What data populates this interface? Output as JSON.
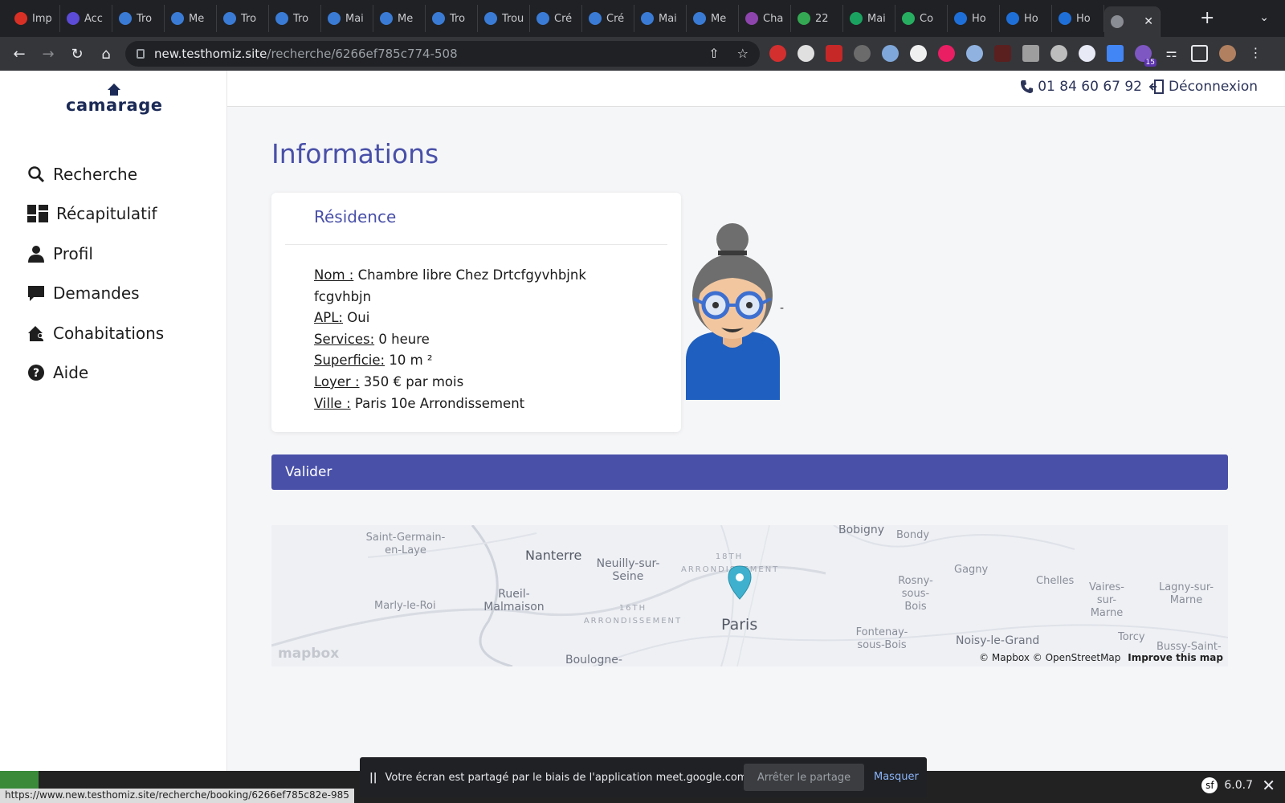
{
  "browser": {
    "tabs": [
      {
        "title": "Imp",
        "icon": "gmail-icon",
        "color": "#d93025"
      },
      {
        "title": "Acc",
        "icon": "account-icon",
        "color": "#5b4bd6"
      },
      {
        "title": "Tro",
        "icon": "c-icon",
        "color": "#3a7bd5"
      },
      {
        "title": "Me",
        "icon": "c-icon",
        "color": "#3a7bd5"
      },
      {
        "title": "Tro",
        "icon": "c-icon",
        "color": "#3a7bd5"
      },
      {
        "title": "Tro",
        "icon": "c-icon",
        "color": "#3a7bd5"
      },
      {
        "title": "Mai",
        "icon": "c-icon",
        "color": "#3a7bd5"
      },
      {
        "title": "Me",
        "icon": "c-icon",
        "color": "#3a7bd5"
      },
      {
        "title": "Tro",
        "icon": "c-icon",
        "color": "#3a7bd5"
      },
      {
        "title": "Trou",
        "icon": "c-icon",
        "color": "#3a7bd5"
      },
      {
        "title": "Cré",
        "icon": "c-icon",
        "color": "#3a7bd5"
      },
      {
        "title": "Cré",
        "icon": "c-icon",
        "color": "#3a7bd5"
      },
      {
        "title": "Mai",
        "icon": "c-icon",
        "color": "#3a7bd5"
      },
      {
        "title": "Me",
        "icon": "c-icon",
        "color": "#3a7bd5"
      },
      {
        "title": "Cha",
        "icon": "trello-icon",
        "color": "#8e44ad"
      },
      {
        "title": "22",
        "icon": "maps-icon",
        "color": "#34a853"
      },
      {
        "title": "Mai",
        "icon": "mail-icon",
        "color": "#1aa260"
      },
      {
        "title": "Co",
        "icon": "leaf-icon",
        "color": "#27ae60"
      },
      {
        "title": "Ho",
        "icon": "swirl-icon",
        "color": "#1f6fd8"
      },
      {
        "title": "Ho",
        "icon": "swirl-icon",
        "color": "#1f6fd8"
      },
      {
        "title": "Ho",
        "icon": "swirl-icon",
        "color": "#1f6fd8"
      }
    ],
    "url_host": "new.testhomiz.site",
    "url_path": "/recherche/6266ef785c774-508",
    "extension_badge": "15"
  },
  "brand": {
    "name": "camarage",
    "color": "#1b2a56"
  },
  "sidebar": {
    "items": [
      {
        "label": "Recherche",
        "icon": "search-icon"
      },
      {
        "label": "Récapitulatif",
        "icon": "dashboard-icon"
      },
      {
        "label": "Profil",
        "icon": "user-icon"
      },
      {
        "label": "Demandes",
        "icon": "chat-icon"
      },
      {
        "label": "Cohabitations",
        "icon": "home-users-icon"
      },
      {
        "label": "Aide",
        "icon": "help-icon"
      }
    ]
  },
  "topbar": {
    "phone": "01 84 60 67 92",
    "logout": "Déconnexion"
  },
  "main": {
    "title": "Informations",
    "accent": "#4950a8",
    "card": {
      "title": "Résidence",
      "fields": [
        {
          "label": "Nom :",
          "value": " Chambre libre Chez Drtcfgyvhbjnk fcgvhbjn"
        },
        {
          "label": "APL:",
          "value": " Oui"
        },
        {
          "label": "Services:",
          "value": " 0 heure"
        },
        {
          "label": "Superficie:",
          "value": " 10 m ²"
        },
        {
          "label": "Loyer :",
          "value": " 350 € par mois"
        },
        {
          "label": "Ville :",
          "value": " Paris 10e Arrondissement"
        }
      ]
    },
    "avatar_dash": "-",
    "validate_label": "Valider"
  },
  "map": {
    "labels": [
      "Saint-Germain-en-Laye",
      "Nanterre",
      "Neuilly-sur-Seine",
      "18TH ARRONDISSEMENT",
      "Bobigny",
      "Bondy",
      "Gagny",
      "Rosny-sous-Bois",
      "Chelles",
      "Vaires-sur-Marne",
      "Lagny-sur-Marne",
      "Marly-le-Roi",
      "Rueil-Malmaison",
      "16TH ARRONDISSEMENT",
      "Paris",
      "Fontenay-sous-Bois",
      "Noisy-le-Grand",
      "Torcy",
      "Bussy-Saint-",
      "Boulogne-"
    ],
    "logo": "mapbox",
    "attribution": "© Mapbox © OpenStreetMap",
    "improve": "Improve this map"
  },
  "screen_share": {
    "message": "Votre écran est partagé par le biais de l'application meet.google.com.",
    "stop": "Arrêter le partage",
    "hide": "Masquer"
  },
  "statusbar": {
    "url": "https://www.new.testhomiz.site/recherche/booking/6266ef785c82e-985",
    "symfony_version": "6.0.7"
  }
}
